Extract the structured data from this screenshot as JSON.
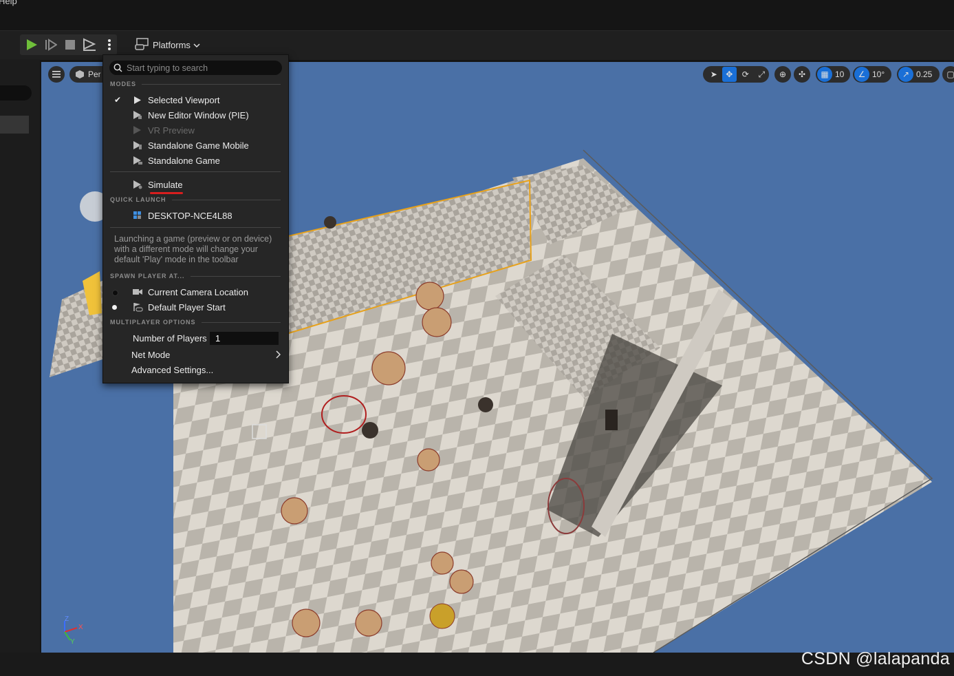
{
  "menubar": {
    "help_label": "Help"
  },
  "toolbar": {
    "play_icon": "play-icon",
    "advance_icon": "advance-frame-icon",
    "stop_icon": "stop-icon",
    "eject_icon": "eject-icon",
    "more_icon": "more-options-icon",
    "platforms_label": "Platforms",
    "colors": {
      "play": "#6fbf3a"
    }
  },
  "viewport": {
    "perspective_label": "Per",
    "grid_snap": "10",
    "rotation_snap": "10°",
    "scale_snap": "0.25",
    "axis": {
      "z": "Z",
      "x": "X",
      "y": "Y"
    }
  },
  "menu": {
    "search_placeholder": "Start typing to search",
    "modes_header": "MODES",
    "modes": [
      {
        "label": "Selected Viewport",
        "checked": true,
        "enabled": true
      },
      {
        "label": "New Editor Window (PIE)",
        "checked": false,
        "enabled": true
      },
      {
        "label": "VR Preview",
        "checked": false,
        "enabled": false
      },
      {
        "label": "Standalone Game Mobile",
        "checked": false,
        "enabled": true
      },
      {
        "label": "Standalone Game",
        "checked": false,
        "enabled": true
      }
    ],
    "simulate_label": "Simulate",
    "quick_launch_header": "QUICK LAUNCH",
    "quick_launch_device": "DESKTOP-NCE4L88",
    "help_text": "Launching a game (preview or on device) with a different mode will change your default 'Play' mode in the toolbar",
    "spawn_header": "SPAWN PLAYER AT...",
    "spawn_options": [
      {
        "label": "Current Camera Location",
        "selected": false
      },
      {
        "label": "Default Player Start",
        "selected": true
      }
    ],
    "multiplayer_header": "MULTIPLAYER OPTIONS",
    "players_label": "Number of Players",
    "players_value": "1",
    "net_mode_label": "Net Mode",
    "advanced_label": "Advanced Settings...",
    "colors": {
      "underline": "#d81e1e"
    }
  },
  "watermark": "CSDN @lalapanda"
}
